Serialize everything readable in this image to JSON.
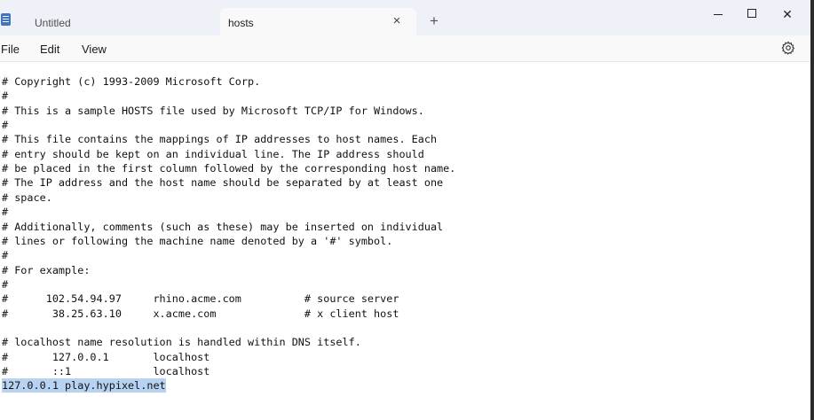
{
  "tabs": [
    {
      "label": "Untitled",
      "active": false
    },
    {
      "label": "hosts",
      "active": true
    }
  ],
  "tab_close_glyph": "×",
  "new_tab_glyph": "+",
  "window_close_glyph": "✕",
  "menu": {
    "file": "File",
    "edit": "Edit",
    "view": "View"
  },
  "icons": {
    "app": "notepad-icon",
    "settings": "gear-icon"
  },
  "colors": {
    "selection": "#b8d3f1",
    "tabbar": "#eef2f8",
    "active_tab": "#f9f9f9"
  },
  "editor": {
    "lines": [
      "# Copyright (c) 1993-2009 Microsoft Corp.",
      "#",
      "# This is a sample HOSTS file used by Microsoft TCP/IP for Windows.",
      "#",
      "# This file contains the mappings of IP addresses to host names. Each",
      "# entry should be kept on an individual line. The IP address should",
      "# be placed in the first column followed by the corresponding host name.",
      "# The IP address and the host name should be separated by at least one",
      "# space.",
      "#",
      "# Additionally, comments (such as these) may be inserted on individual",
      "# lines or following the machine name denoted by a '#' symbol.",
      "#",
      "# For example:",
      "#",
      "#      102.54.94.97     rhino.acme.com          # source server",
      "#       38.25.63.10     x.acme.com              # x client host",
      "",
      "# localhost name resolution is handled within DNS itself.",
      "#       127.0.0.1       localhost",
      "#       ::1             localhost",
      "127.0.0.1 play.hypixel.net"
    ],
    "selected_line": "127.0.0.1 play.hypixel.net"
  }
}
